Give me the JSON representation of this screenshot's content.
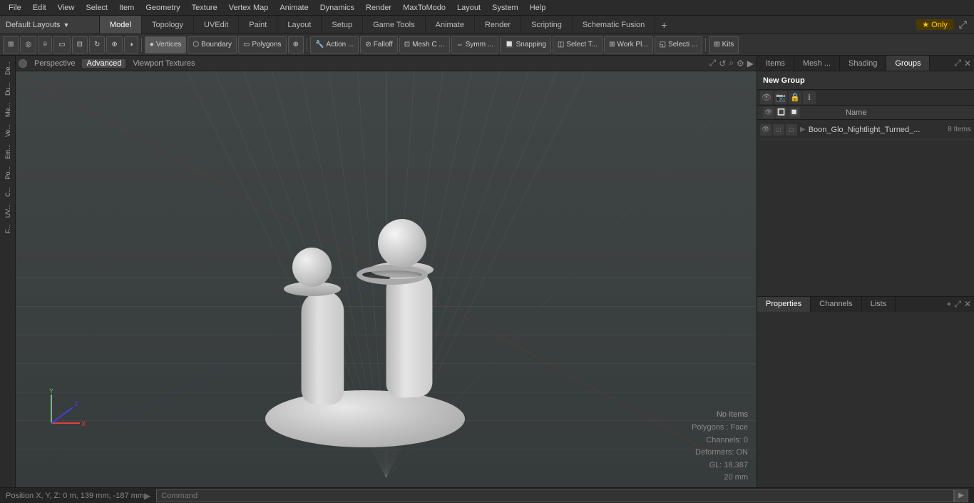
{
  "menubar": {
    "items": [
      "File",
      "Edit",
      "View",
      "Select",
      "Item",
      "Geometry",
      "Texture",
      "Vertex Map",
      "Animate",
      "Dynamics",
      "Render",
      "MaxToModo",
      "Layout",
      "System",
      "Help"
    ]
  },
  "layout": {
    "dropdown_label": "Default Layouts",
    "tabs": [
      "Model",
      "Topology",
      "UVEdit",
      "Paint",
      "Layout",
      "Setup",
      "Game Tools",
      "Animate",
      "Render",
      "Scripting",
      "Schematic Fusion"
    ],
    "add_icon": "+",
    "star_only": "★ Only"
  },
  "toolbar": {
    "buttons": [
      "Vertices",
      "Boundary",
      "Polygons",
      "Action ...",
      "Falloff",
      "Mesh C ...",
      "Symm ...",
      "Snapping",
      "Select T...",
      "Work Pl...",
      "Selecti ...",
      "Kits"
    ]
  },
  "viewport": {
    "circle_label": "●",
    "labels": [
      "Perspective",
      "Advanced",
      "Viewport Textures"
    ],
    "icons": [
      "⤢",
      "↺",
      "⌕",
      "⚙",
      "▶"
    ]
  },
  "stats": {
    "no_items": "No Items",
    "polygons": "Polygons : Face",
    "channels": "Channels: 0",
    "deformers": "Deformers: ON",
    "gl": "GL: 18,387",
    "mm": "20 mm"
  },
  "left_sidebar": {
    "tabs": [
      "De...",
      "Du...",
      "Me...",
      "Ve...",
      "Em...",
      "Po...",
      "C...",
      "UV...",
      "F..."
    ]
  },
  "right_panel": {
    "top_tabs": [
      "Items",
      "Mesh ...",
      "Shading",
      "Groups"
    ],
    "active_tab": "Groups",
    "groups_header": "New Group",
    "name_col": "Name",
    "group_item": {
      "name": "Boon_Glo_Nightlight_Turned_...",
      "count": "8 Items"
    }
  },
  "bottom_panel": {
    "tabs": [
      "Properties",
      "Channels",
      "Lists"
    ],
    "add_icon": "+"
  },
  "statusbar": {
    "position": "Position X, Y, Z:  0 m, 139 mm, -187 mm",
    "command_placeholder": "Command",
    "arrow": "▶"
  }
}
